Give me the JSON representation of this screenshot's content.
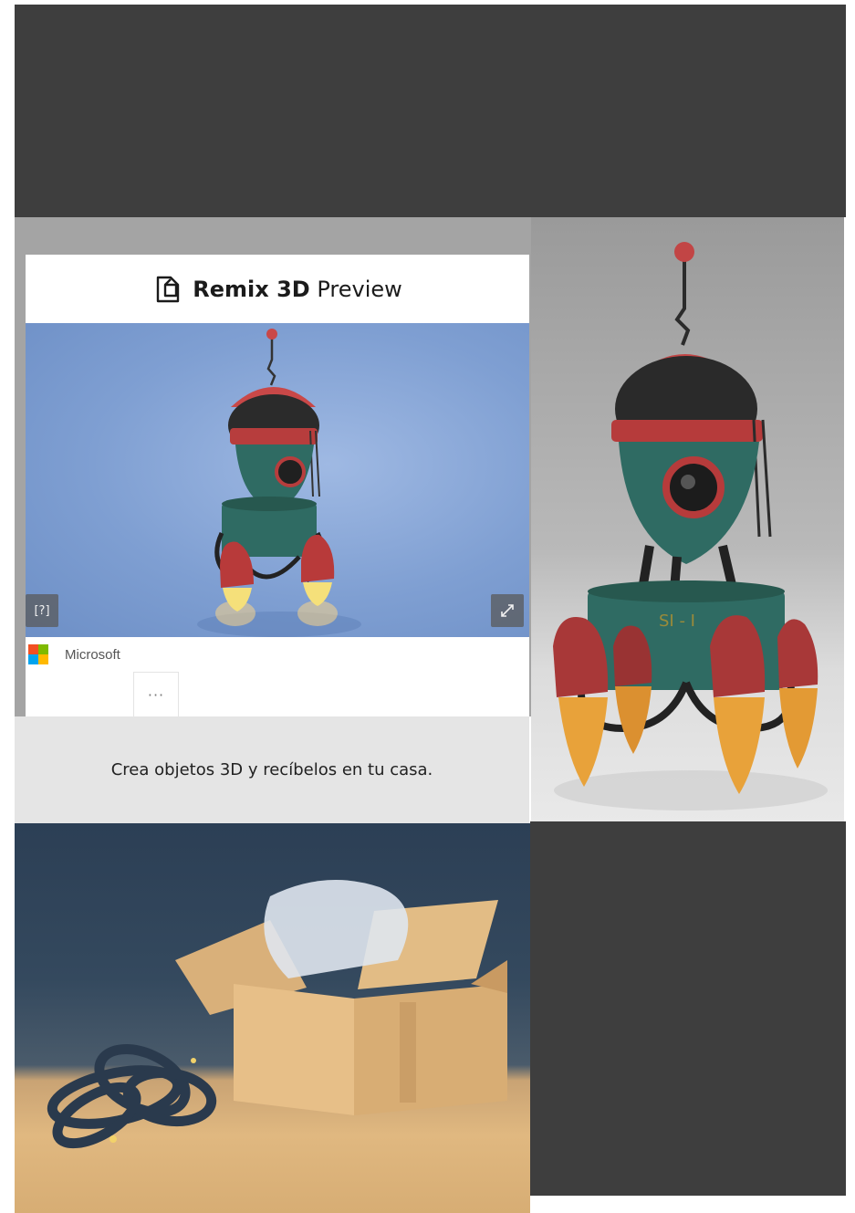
{
  "card": {
    "brand_bold": "Remix 3D",
    "brand_light": "Preview",
    "publisher": "Microsoft",
    "more_label": "···",
    "ar_label": "[?]",
    "expand_icon": "expand-icon"
  },
  "caption": "Crea objetos 3D y recíbelos en tu casa.",
  "rocket_label": "SI - I",
  "colors": {
    "dark_panel": "#3e3e3e",
    "caption_bg": "#e5e5e5",
    "rocket_teal": "#2f6b63",
    "rocket_red": "#b83a3a",
    "flame": "#e8a23a",
    "ms_red": "#f25022",
    "ms_green": "#7fba00",
    "ms_blue": "#00a4ef",
    "ms_yellow": "#ffb900"
  }
}
